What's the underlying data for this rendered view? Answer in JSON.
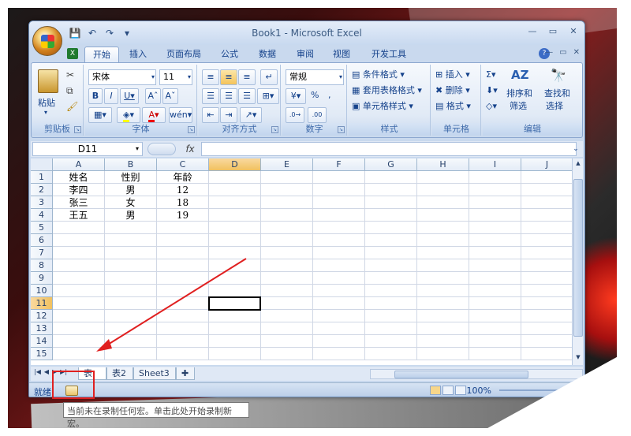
{
  "window": {
    "title": "Book1 - Microsoft Excel",
    "controls": [
      "—",
      "▭",
      "✕"
    ]
  },
  "ribbon_tabs": [
    {
      "label": "开始",
      "active": true
    },
    {
      "label": "插入"
    },
    {
      "label": "页面布局"
    },
    {
      "label": "公式"
    },
    {
      "label": "数据"
    },
    {
      "label": "审阅"
    },
    {
      "label": "视图"
    },
    {
      "label": "开发工具"
    }
  ],
  "groups": {
    "clipboard": {
      "label": "剪贴板",
      "paste": "粘贴"
    },
    "font": {
      "label": "字体",
      "font_name": "宋体",
      "font_size": "11"
    },
    "alignment": {
      "label": "对齐方式"
    },
    "number": {
      "label": "数字",
      "format": "常规",
      "percent": "%"
    },
    "styles": {
      "label": "样式",
      "conditional": "条件格式",
      "table": "套用表格格式",
      "cell_styles": "单元格样式"
    },
    "cells": {
      "label": "单元格",
      "insert": "插入",
      "delete": "删除",
      "format": "格式"
    },
    "editing": {
      "label": "编辑",
      "sort": "排序和",
      "sort2": "筛选",
      "find": "查找和",
      "find2": "选择"
    }
  },
  "formula_bar": {
    "name_box": "D11",
    "fx": "fx",
    "content": ""
  },
  "columns": [
    "A",
    "B",
    "C",
    "D",
    "E",
    "F",
    "G",
    "H",
    "I",
    "J"
  ],
  "rows": [
    "1",
    "2",
    "3",
    "4",
    "5",
    "6",
    "7",
    "8",
    "9",
    "10",
    "11",
    "12",
    "13",
    "14",
    "15"
  ],
  "table": [
    [
      "姓名",
      "性别",
      "年龄"
    ],
    [
      "李四",
      "男",
      "12"
    ],
    [
      "张三",
      "女",
      "18"
    ],
    [
      "王五",
      "男",
      "19"
    ]
  ],
  "active_cell": "D11",
  "sheet_tabs": [
    "表.",
    "表2",
    "Sheet3"
  ],
  "status": {
    "ready": "就绪",
    "zoom": "100%"
  },
  "tooltip": "当前未在录制任何宏。单击此处开始录制新宏。",
  "colors": {
    "annotation": "#e02020",
    "selected_header": "#f1c15f"
  }
}
